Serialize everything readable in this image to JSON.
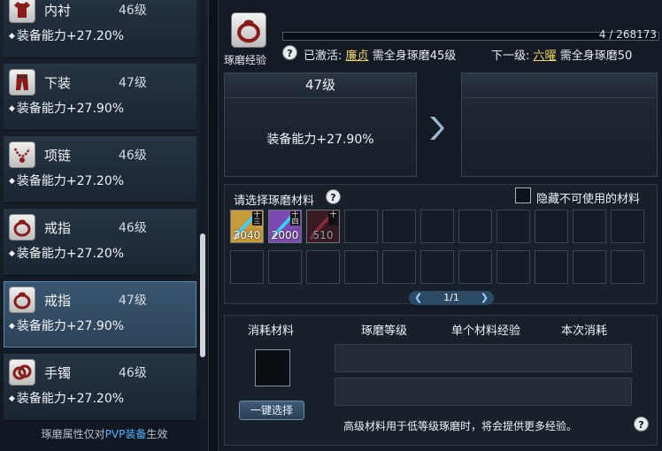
{
  "left": {
    "slots": [
      {
        "name": "内衬",
        "level": "46级",
        "ability": "装备能力+27.20%",
        "icon": "shirt-icon",
        "selected": false
      },
      {
        "name": "下装",
        "level": "47级",
        "ability": "装备能力+27.90%",
        "icon": "pants-icon",
        "selected": false
      },
      {
        "name": "项链",
        "level": "46级",
        "ability": "装备能力+27.20%",
        "icon": "necklace-icon",
        "selected": false
      },
      {
        "name": "戒指",
        "level": "46级",
        "ability": "装备能力+27.20%",
        "icon": "ring-icon",
        "selected": false
      },
      {
        "name": "戒指",
        "level": "47级",
        "ability": "装备能力+27.90%",
        "icon": "ring-icon",
        "selected": true
      },
      {
        "name": "手镯",
        "level": "46级",
        "ability": "装备能力+27.20%",
        "icon": "bracelet-icon",
        "selected": false
      }
    ],
    "footnote_prefix": "琢磨属性仅对",
    "footnote_highlight": "PVP装备",
    "footnote_suffix": "生效"
  },
  "header": {
    "exp_label": "琢磨经验",
    "exp_current": "4",
    "exp_max": "268173",
    "exp_progress": 1.49e-05,
    "help_label": "?",
    "activated_label": "已激活:",
    "activated_title": "廉贞",
    "activated_desc": "需全身琢磨45级",
    "next_label": "下一级:",
    "next_title": "六曜",
    "next_desc": "需全身琢磨50"
  },
  "current": {
    "level": "47级",
    "ability": "装备能力+27.90%"
  },
  "materials": {
    "title": "请选择琢磨材料",
    "help_label": "?",
    "hide_label": "隐藏不可使用的材料",
    "items": [
      {
        "count": "3040",
        "badge": "十三",
        "usable": true
      },
      {
        "count": "2000",
        "badge": "十四",
        "usable": true
      },
      {
        "count": "510",
        "badge": "十",
        "usable": false
      }
    ],
    "page": "1/1"
  },
  "consume": {
    "col_material": "消耗材料",
    "col_level": "琢磨等级",
    "col_exp": "单个材料经验",
    "col_cost": "本次消耗",
    "button": "一键选择",
    "hint": "高级材料用于低等级琢磨时，将会提供更多经验。",
    "help_label": "?"
  },
  "colors": {
    "accent_blue": "#4fb6ff",
    "gold": "#f3d76b",
    "selected_slot": "#3a5670"
  }
}
